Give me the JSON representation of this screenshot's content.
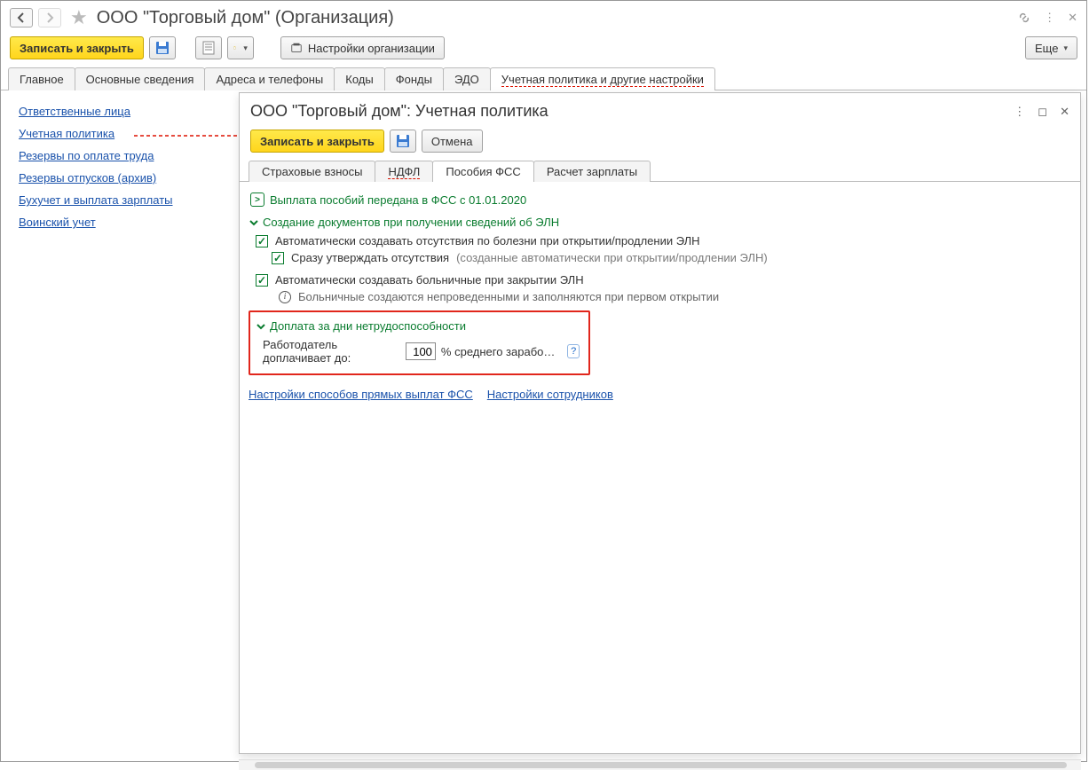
{
  "titlebar": {
    "title": "ООО \"Торговый дом\" (Организация)"
  },
  "cmdbar": {
    "save_close": "Записать и закрыть",
    "settings": "Настройки организации",
    "more": "Еще"
  },
  "tabs": [
    {
      "label": "Главное"
    },
    {
      "label": "Основные сведения"
    },
    {
      "label": "Адреса и телефоны"
    },
    {
      "label": "Коды"
    },
    {
      "label": "Фонды"
    },
    {
      "label": "ЭДО"
    },
    {
      "label": "Учетная политика и другие настройки"
    }
  ],
  "sidebar": [
    "Ответственные лица",
    "Учетная политика",
    "Резервы по оплате труда",
    "Резервы отпусков (архив)",
    "Бухучет и выплата зарплаты",
    "Воинский учет"
  ],
  "panel": {
    "title": "ООО \"Торговый дом\": Учетная политика",
    "save_close": "Записать и закрыть",
    "cancel": "Отмена",
    "subtabs": [
      "Страховые взносы",
      "НДФЛ",
      "Пособия ФСС",
      "Расчет зарплаты"
    ],
    "fss_transfer": "Выплата пособий передана в ФСС с 01.01.2020",
    "sect1_title": "Создание документов при получении сведений об ЭЛН",
    "chk1": "Автоматически создавать отсутствия по болезни при открытии/продлении ЭЛН",
    "chk1a": "Сразу утверждать отсутствия",
    "chk1a_hint": "(созданные автоматически при открытии/продлении ЭЛН)",
    "chk2": "Автоматически создавать больничные при закрытии ЭЛН",
    "chk2_info": "Больничные создаются непроведенными и заполняются при первом открытии",
    "sect2_title": "Доплата за дни нетрудоспособности",
    "employer_label": "Работодатель доплачивает до:",
    "employer_value": "100",
    "employer_suffix": "%  среднего зарабо…",
    "link1": "Настройки способов прямых выплат ФСС",
    "link2": "Настройки сотрудников"
  }
}
